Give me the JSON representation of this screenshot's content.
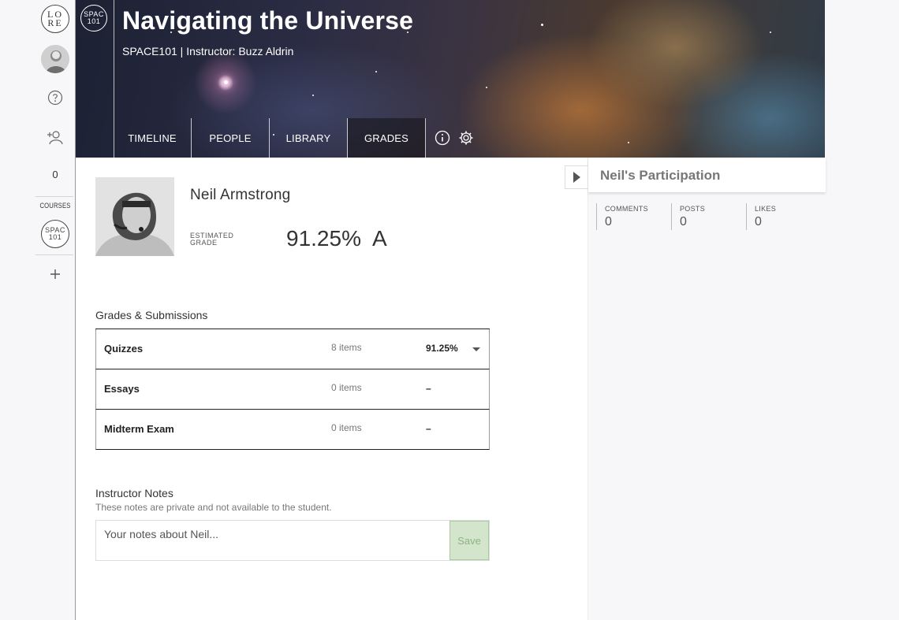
{
  "rail": {
    "logo_text": "LO RE",
    "count": "0",
    "courses_label": "COURSES",
    "course_badge": "SPAC 101"
  },
  "banner": {
    "badge": "SPAC 101",
    "title": "Navigating the Universe",
    "subtitle": "SPACE101 | Instructor: Buzz Aldrin",
    "tabs": [
      {
        "label": "TIMELINE",
        "active": false
      },
      {
        "label": "PEOPLE",
        "active": false
      },
      {
        "label": "LIBRARY",
        "active": false
      },
      {
        "label": "GRADES",
        "active": true
      }
    ]
  },
  "student": {
    "name": "Neil Armstrong",
    "estimated_label": "ESTIMATED GRADE",
    "estimated_percent": "91.25%",
    "estimated_letter": "A"
  },
  "grades": {
    "title": "Grades & Submissions",
    "rows": [
      {
        "name": "Quizzes",
        "items": "8 items",
        "score": "91.25%",
        "expandable": true
      },
      {
        "name": "Essays",
        "items": "0 items",
        "score": "–",
        "expandable": false
      },
      {
        "name": "Midterm Exam",
        "items": "0 items",
        "score": "–",
        "expandable": false
      }
    ]
  },
  "notes": {
    "title": "Instructor Notes",
    "subtitle": "These notes are private and not available to the student.",
    "placeholder": "Your notes about Neil...",
    "save_label": "Save"
  },
  "participation": {
    "title": "Neil's Participation",
    "stats": [
      {
        "label": "COMMENTS",
        "value": "0"
      },
      {
        "label": "POSTS",
        "value": "0"
      },
      {
        "label": "LIKES",
        "value": "0"
      }
    ]
  },
  "colors": {
    "save_bg": "#d3e6cc",
    "accent_text": "#777777"
  },
  "icons": [
    "lore-logo",
    "avatar",
    "help-icon",
    "add-user-icon",
    "plus-icon",
    "info-icon",
    "gear-icon",
    "expand-icon",
    "chevron-down-icon"
  ]
}
